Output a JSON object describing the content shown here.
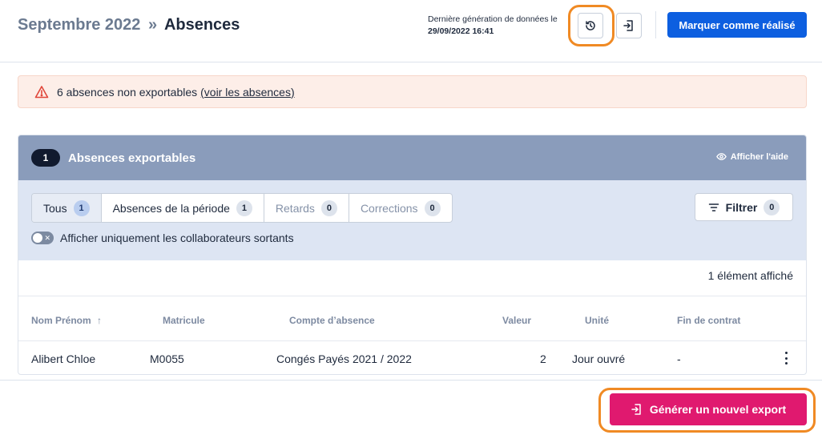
{
  "header": {
    "breadcrumb_parent": "Septembre 2022",
    "breadcrumb_separator": "»",
    "breadcrumb_current": "Absences",
    "generation_label": "Dernière génération de données le",
    "generation_date": "29/09/2022 16:41",
    "history_icon": "history-icon",
    "export_icon": "export-icon",
    "mark_done_label": "Marquer comme réalisé"
  },
  "alert": {
    "icon": "warning-icon",
    "text": "6 absences non exportables",
    "link": "(voir les absences)"
  },
  "panel": {
    "count": "1",
    "title": "Absences exportables",
    "help_label": "Afficher l'aide",
    "tabs": [
      {
        "label": "Tous",
        "count": "1"
      },
      {
        "label": "Absences de la période",
        "count": "1"
      },
      {
        "label": "Retards",
        "count": "0"
      },
      {
        "label": "Corrections",
        "count": "0"
      }
    ],
    "filter_label": "Filtrer",
    "filter_count": "0",
    "toggle_label": "Afficher uniquement les collaborateurs sortants",
    "result_count": "1 élément affiché"
  },
  "table": {
    "columns": [
      "Nom Prénom",
      "Matricule",
      "Compte d’absence",
      "Valeur",
      "Unité",
      "Fin de contrat"
    ],
    "sort_indicator": "↑",
    "rows": [
      {
        "name": "Alibert Chloe",
        "id": "M0055",
        "account": "Congés Payés 2021 / 2022",
        "value": "2",
        "unit": "Jour ouvré",
        "contract_end": "-"
      }
    ]
  },
  "footer": {
    "export_label": "Générer un nouvel export"
  },
  "colors": {
    "primary": "#0d5fe0",
    "export": "#e0196f",
    "highlight": "#f08a24",
    "panel_header": "#8a9cbb"
  }
}
